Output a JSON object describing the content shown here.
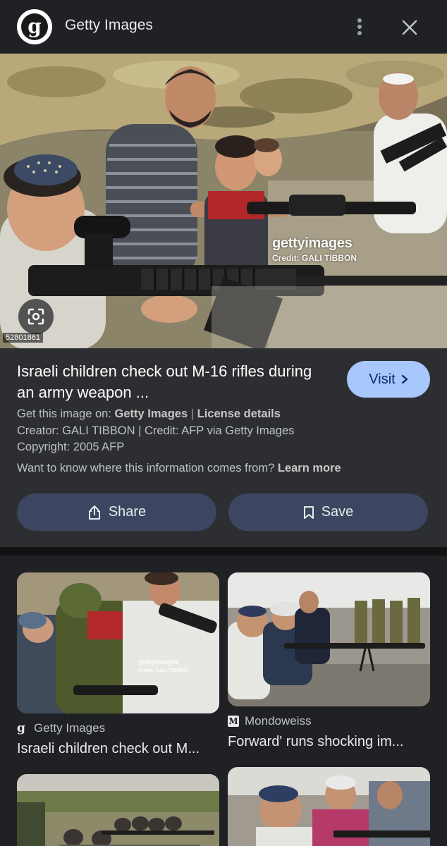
{
  "header": {
    "logo_letter": "g",
    "site_name": "Getty Images"
  },
  "main_image": {
    "watermark_brand": "gettyimages",
    "watermark_credit": "Credit: GALI TIBBON",
    "image_id": "52801861"
  },
  "info": {
    "title": "Israeli children check out M-16 rifles during an army weapon ...",
    "visit_label": "Visit",
    "get_image_prefix": "Get this image on:",
    "get_image_source": "Getty Images",
    "separator": "|",
    "license_details": "License details",
    "creator_line": "Creator: GALI TIBBON | Credit: AFP via Getty Images",
    "copyright_line": "Copyright: 2005 AFP",
    "info_question": "Want to know where this information comes from?",
    "learn_more": "Learn more",
    "share_label": "Share",
    "save_label": "Save"
  },
  "related": [
    {
      "source": "Getty Images",
      "favicon_letter": "g",
      "title": "Israeli children check out M...",
      "watermark": "gettyimages",
      "watermark_credit": "Credit: GALI TIBBON"
    },
    {
      "source": "Mondoweiss",
      "favicon_letter": "M",
      "title": "Forward' runs shocking im..."
    }
  ],
  "colors": {
    "background": "#202124",
    "panel": "#2d2e31",
    "visit_button": "#a8c7fa",
    "action_button": "#3c4660"
  }
}
